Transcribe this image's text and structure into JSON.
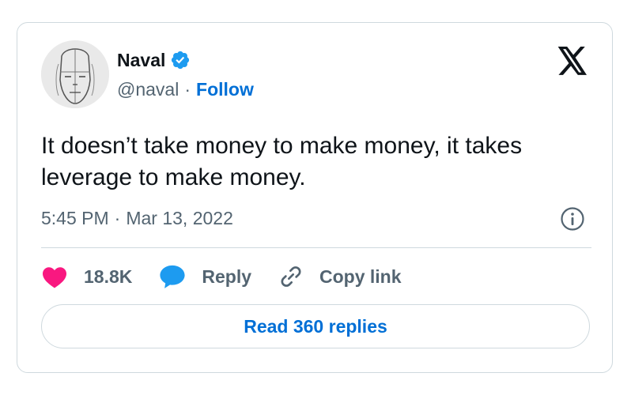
{
  "author": {
    "name": "Naval",
    "handle": "@naval",
    "separator": "·",
    "follow_label": "Follow",
    "verified_icon": "verified-badge-icon"
  },
  "tweet": {
    "text": "It doesn’t take money to make money, it takes leverage to make money.",
    "time": "5:45 PM",
    "separator": "·",
    "date": "Mar 13, 2022"
  },
  "actions": {
    "like_count": "18.8K",
    "reply_label": "Reply",
    "copy_link_label": "Copy link"
  },
  "read_replies_label": "Read 360 replies",
  "icons": {
    "platform_logo": "x-logo-icon",
    "info": "info-icon",
    "like": "heart-icon",
    "reply": "speech-bubble-icon",
    "copy_link": "link-icon"
  },
  "colors": {
    "link_blue": "#006fd6",
    "verified_blue": "#1d9bf0",
    "like_pink": "#f91880",
    "secondary_text": "#536471",
    "border": "#cfd9de"
  }
}
